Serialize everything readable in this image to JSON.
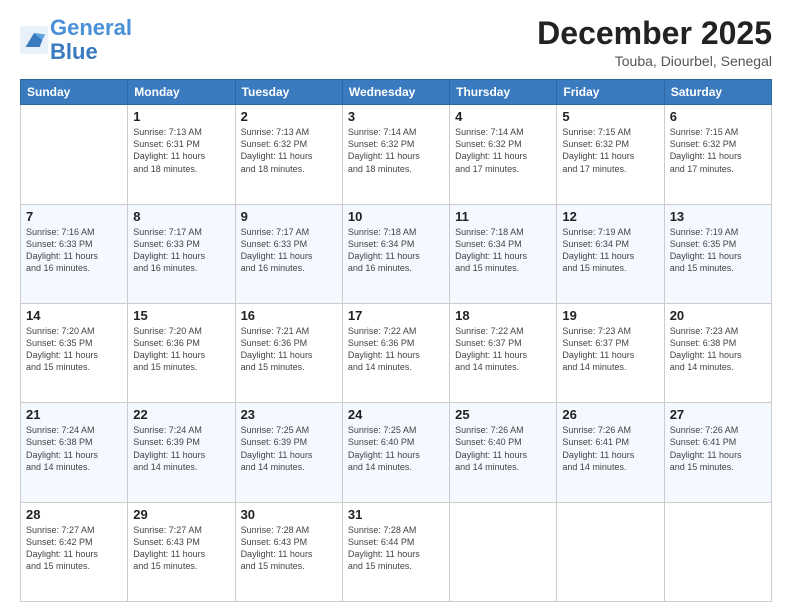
{
  "logo": {
    "line1": "General",
    "line2": "Blue"
  },
  "title": "December 2025",
  "subtitle": "Touba, Diourbel, Senegal",
  "days_of_week": [
    "Sunday",
    "Monday",
    "Tuesday",
    "Wednesday",
    "Thursday",
    "Friday",
    "Saturday"
  ],
  "weeks": [
    [
      {
        "day": "",
        "info": ""
      },
      {
        "day": "1",
        "info": "Sunrise: 7:13 AM\nSunset: 6:31 PM\nDaylight: 11 hours\nand 18 minutes."
      },
      {
        "day": "2",
        "info": "Sunrise: 7:13 AM\nSunset: 6:32 PM\nDaylight: 11 hours\nand 18 minutes."
      },
      {
        "day": "3",
        "info": "Sunrise: 7:14 AM\nSunset: 6:32 PM\nDaylight: 11 hours\nand 18 minutes."
      },
      {
        "day": "4",
        "info": "Sunrise: 7:14 AM\nSunset: 6:32 PM\nDaylight: 11 hours\nand 17 minutes."
      },
      {
        "day": "5",
        "info": "Sunrise: 7:15 AM\nSunset: 6:32 PM\nDaylight: 11 hours\nand 17 minutes."
      },
      {
        "day": "6",
        "info": "Sunrise: 7:15 AM\nSunset: 6:32 PM\nDaylight: 11 hours\nand 17 minutes."
      }
    ],
    [
      {
        "day": "7",
        "info": "Sunrise: 7:16 AM\nSunset: 6:33 PM\nDaylight: 11 hours\nand 16 minutes."
      },
      {
        "day": "8",
        "info": "Sunrise: 7:17 AM\nSunset: 6:33 PM\nDaylight: 11 hours\nand 16 minutes."
      },
      {
        "day": "9",
        "info": "Sunrise: 7:17 AM\nSunset: 6:33 PM\nDaylight: 11 hours\nand 16 minutes."
      },
      {
        "day": "10",
        "info": "Sunrise: 7:18 AM\nSunset: 6:34 PM\nDaylight: 11 hours\nand 16 minutes."
      },
      {
        "day": "11",
        "info": "Sunrise: 7:18 AM\nSunset: 6:34 PM\nDaylight: 11 hours\nand 15 minutes."
      },
      {
        "day": "12",
        "info": "Sunrise: 7:19 AM\nSunset: 6:34 PM\nDaylight: 11 hours\nand 15 minutes."
      },
      {
        "day": "13",
        "info": "Sunrise: 7:19 AM\nSunset: 6:35 PM\nDaylight: 11 hours\nand 15 minutes."
      }
    ],
    [
      {
        "day": "14",
        "info": "Sunrise: 7:20 AM\nSunset: 6:35 PM\nDaylight: 11 hours\nand 15 minutes."
      },
      {
        "day": "15",
        "info": "Sunrise: 7:20 AM\nSunset: 6:36 PM\nDaylight: 11 hours\nand 15 minutes."
      },
      {
        "day": "16",
        "info": "Sunrise: 7:21 AM\nSunset: 6:36 PM\nDaylight: 11 hours\nand 15 minutes."
      },
      {
        "day": "17",
        "info": "Sunrise: 7:22 AM\nSunset: 6:36 PM\nDaylight: 11 hours\nand 14 minutes."
      },
      {
        "day": "18",
        "info": "Sunrise: 7:22 AM\nSunset: 6:37 PM\nDaylight: 11 hours\nand 14 minutes."
      },
      {
        "day": "19",
        "info": "Sunrise: 7:23 AM\nSunset: 6:37 PM\nDaylight: 11 hours\nand 14 minutes."
      },
      {
        "day": "20",
        "info": "Sunrise: 7:23 AM\nSunset: 6:38 PM\nDaylight: 11 hours\nand 14 minutes."
      }
    ],
    [
      {
        "day": "21",
        "info": "Sunrise: 7:24 AM\nSunset: 6:38 PM\nDaylight: 11 hours\nand 14 minutes."
      },
      {
        "day": "22",
        "info": "Sunrise: 7:24 AM\nSunset: 6:39 PM\nDaylight: 11 hours\nand 14 minutes."
      },
      {
        "day": "23",
        "info": "Sunrise: 7:25 AM\nSunset: 6:39 PM\nDaylight: 11 hours\nand 14 minutes."
      },
      {
        "day": "24",
        "info": "Sunrise: 7:25 AM\nSunset: 6:40 PM\nDaylight: 11 hours\nand 14 minutes."
      },
      {
        "day": "25",
        "info": "Sunrise: 7:26 AM\nSunset: 6:40 PM\nDaylight: 11 hours\nand 14 minutes."
      },
      {
        "day": "26",
        "info": "Sunrise: 7:26 AM\nSunset: 6:41 PM\nDaylight: 11 hours\nand 14 minutes."
      },
      {
        "day": "27",
        "info": "Sunrise: 7:26 AM\nSunset: 6:41 PM\nDaylight: 11 hours\nand 15 minutes."
      }
    ],
    [
      {
        "day": "28",
        "info": "Sunrise: 7:27 AM\nSunset: 6:42 PM\nDaylight: 11 hours\nand 15 minutes."
      },
      {
        "day": "29",
        "info": "Sunrise: 7:27 AM\nSunset: 6:43 PM\nDaylight: 11 hours\nand 15 minutes."
      },
      {
        "day": "30",
        "info": "Sunrise: 7:28 AM\nSunset: 6:43 PM\nDaylight: 11 hours\nand 15 minutes."
      },
      {
        "day": "31",
        "info": "Sunrise: 7:28 AM\nSunset: 6:44 PM\nDaylight: 11 hours\nand 15 minutes."
      },
      {
        "day": "",
        "info": ""
      },
      {
        "day": "",
        "info": ""
      },
      {
        "day": "",
        "info": ""
      }
    ]
  ]
}
